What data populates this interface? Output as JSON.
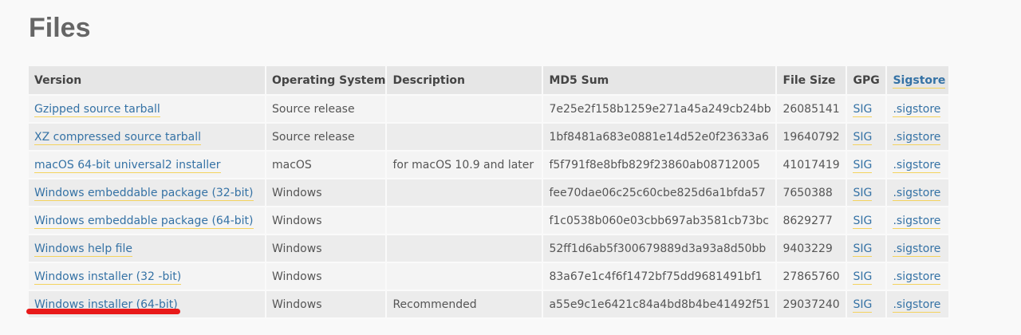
{
  "page": {
    "title": "Files"
  },
  "table": {
    "headers": {
      "version": "Version",
      "os": "Operating System",
      "description": "Description",
      "md5": "MD5 Sum",
      "size": "File Size",
      "gpg": "GPG",
      "sigstore": "Sigstore"
    },
    "rows": [
      {
        "version": "Gzipped source tarball",
        "os": "Source release",
        "description": "",
        "md5": "7e25e2f158b1259e271a45a249cb24bb",
        "size": "26085141",
        "gpg": "SIG",
        "sigstore": ".sigstore"
      },
      {
        "version": "XZ compressed source tarball",
        "os": "Source release",
        "description": "",
        "md5": "1bf8481a683e0881e14d52e0f23633a6",
        "size": "19640792",
        "gpg": "SIG",
        "sigstore": ".sigstore"
      },
      {
        "version": "macOS 64-bit universal2 installer",
        "os": "macOS",
        "description": "for macOS 10.9 and later",
        "md5": "f5f791f8e8bfb829f23860ab08712005",
        "size": "41017419",
        "gpg": "SIG",
        "sigstore": ".sigstore"
      },
      {
        "version": "Windows embeddable package (32-bit)",
        "os": "Windows",
        "description": "",
        "md5": "fee70dae06c25c60cbe825d6a1bfda57",
        "size": "7650388",
        "gpg": "SIG",
        "sigstore": ".sigstore"
      },
      {
        "version": "Windows embeddable package (64-bit)",
        "os": "Windows",
        "description": "",
        "md5": "f1c0538b060e03cbb697ab3581cb73bc",
        "size": "8629277",
        "gpg": "SIG",
        "sigstore": ".sigstore"
      },
      {
        "version": "Windows help file",
        "os": "Windows",
        "description": "",
        "md5": "52ff1d6ab5f300679889d3a93a8d50bb",
        "size": "9403229",
        "gpg": "SIG",
        "sigstore": ".sigstore"
      },
      {
        "version": "Windows installer (32 -bit)",
        "os": "Windows",
        "description": "",
        "md5": "83a67e1c4f6f1472bf75dd9681491bf1",
        "size": "27865760",
        "gpg": "SIG",
        "sigstore": ".sigstore"
      },
      {
        "version": "Windows installer (64-bit)",
        "os": "Windows",
        "description": "Recommended",
        "md5": "a55e9c1e6421c84a4bd8b4be41492f51",
        "size": "29037240",
        "gpg": "SIG",
        "sigstore": ".sigstore"
      }
    ]
  },
  "colors": {
    "link": "#3572a5",
    "link_underline": "#f4d35e",
    "annotation": "#e81a1a"
  }
}
